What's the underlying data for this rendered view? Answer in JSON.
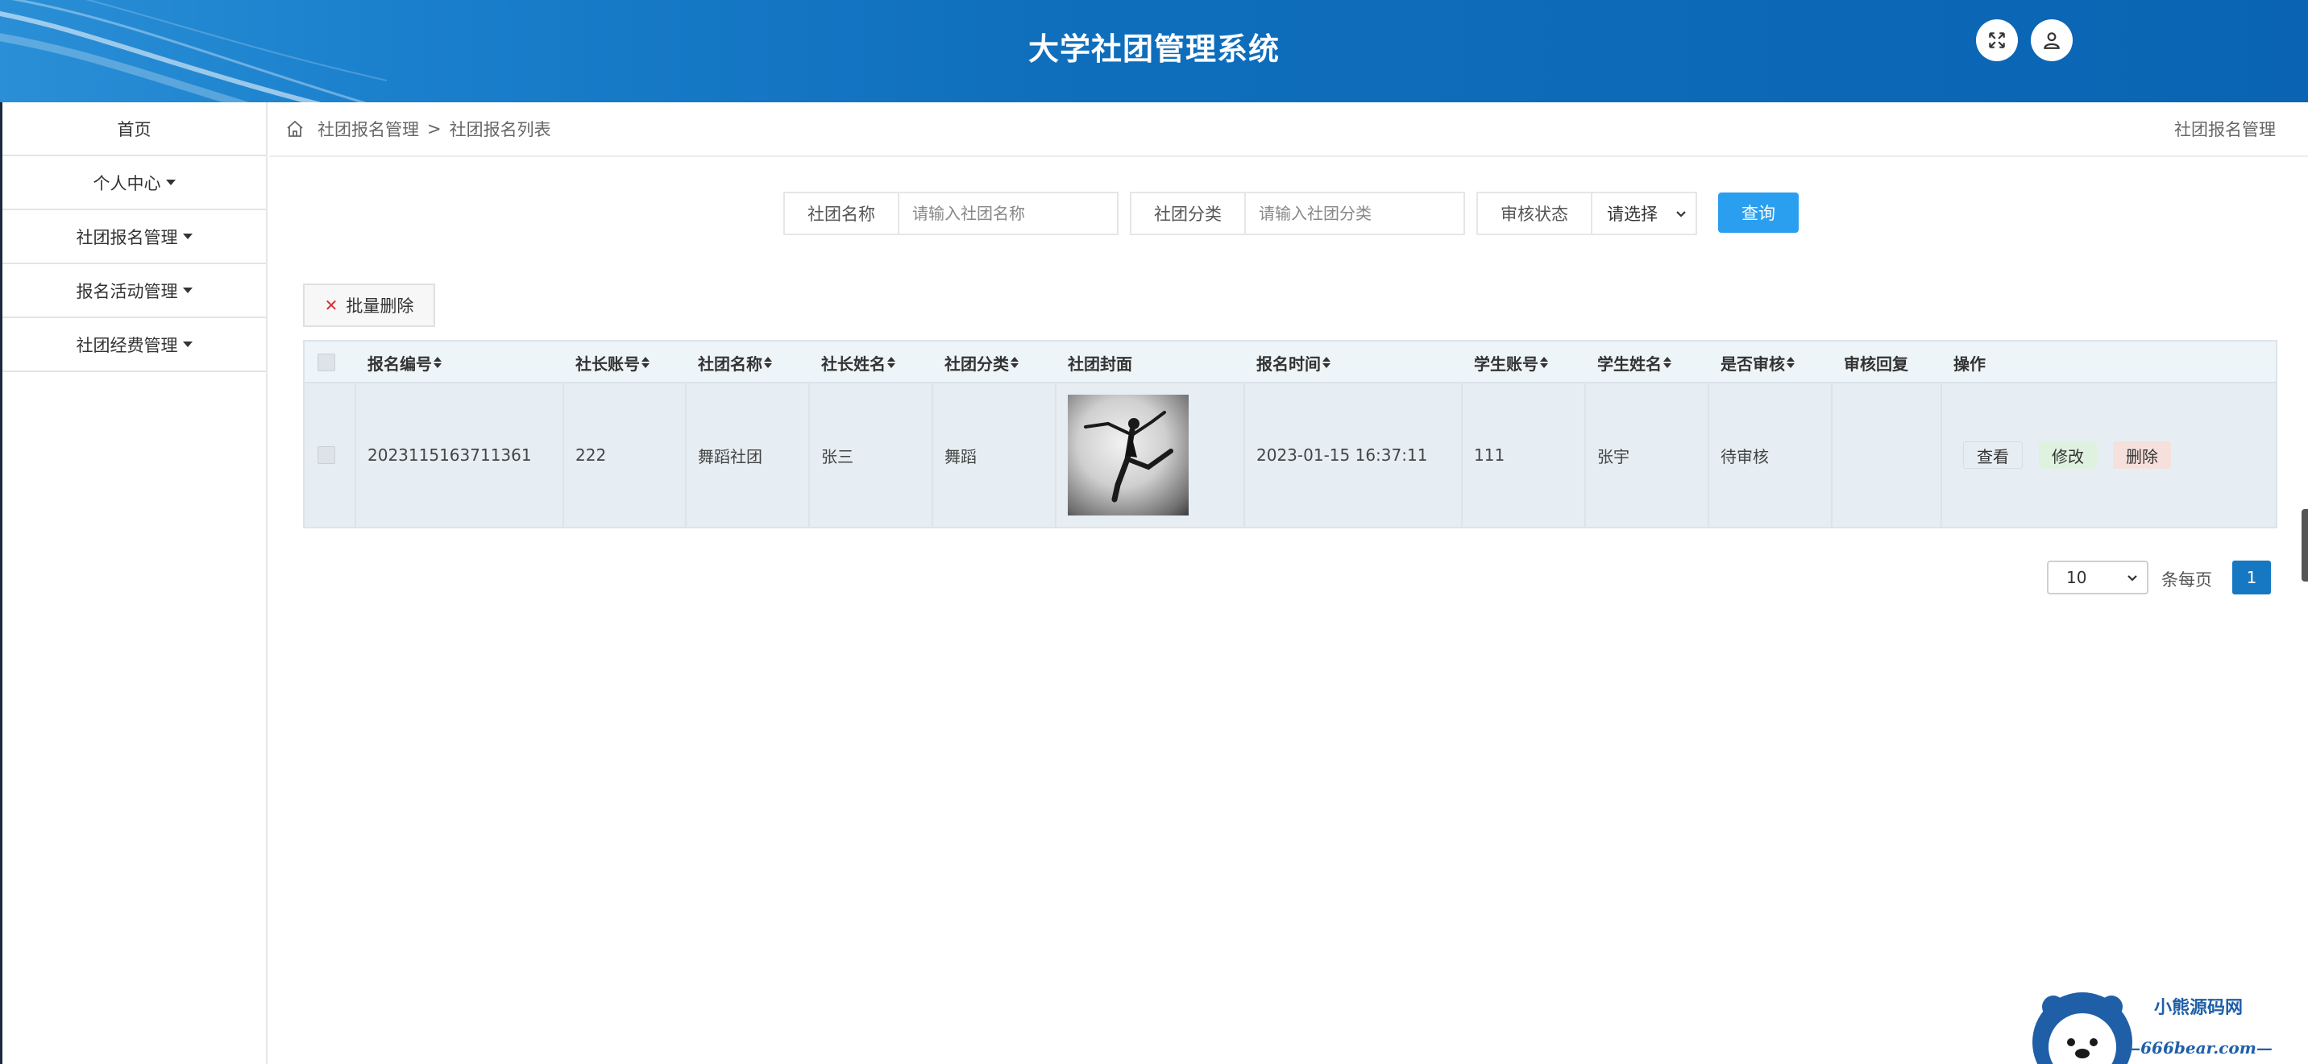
{
  "header": {
    "title": "大学社团管理系统"
  },
  "sidebar": {
    "items": [
      {
        "label": "首页",
        "caret": false
      },
      {
        "label": "个人中心",
        "caret": true
      },
      {
        "label": "社团报名管理",
        "caret": true
      },
      {
        "label": "报名活动管理",
        "caret": true
      },
      {
        "label": "社团经费管理",
        "caret": true
      }
    ]
  },
  "breadcrumb": {
    "level1": "社团报名管理",
    "separator": ">",
    "level2": "社团报名列表",
    "right": "社团报名管理"
  },
  "search": {
    "club_name_label": "社团名称",
    "club_name_placeholder": "请输入社团名称",
    "club_category_label": "社团分类",
    "club_category_placeholder": "请输入社团分类",
    "review_status_label": "审核状态",
    "review_status_value": "请选择",
    "query_button": "查询"
  },
  "batch_delete": "批量删除",
  "table": {
    "columns": [
      "报名编号",
      "社长账号",
      "社团名称",
      "社长姓名",
      "社团分类",
      "社团封面",
      "报名时间",
      "学生账号",
      "学生姓名",
      "是否审核",
      "审核回复",
      "操作"
    ],
    "rows": [
      {
        "reg_no": "2023115163711361",
        "president_account": "222",
        "club_name": "舞蹈社团",
        "president_name": "张三",
        "club_category": "舞蹈",
        "reg_time": "2023-01-15 16:37:11",
        "student_account": "111",
        "student_name": "张宇",
        "reviewed": "待审核",
        "review_reply": "",
        "actions": {
          "view": "查看",
          "edit": "修改",
          "delete": "删除"
        }
      }
    ]
  },
  "pagination": {
    "page_size": "10",
    "per_page_label": "条每页",
    "current_page": "1"
  },
  "watermark": {
    "name": "小熊源码网",
    "url": "—666bear.com—"
  },
  "colors": {
    "header": "#0a64b3",
    "primary_button": "#2a9ff0",
    "page_active": "#1677c2"
  }
}
